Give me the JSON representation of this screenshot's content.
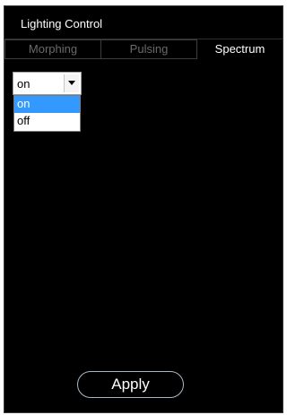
{
  "window": {
    "title": "Lighting Control"
  },
  "tabs": [
    {
      "label": "Morphing",
      "active": false
    },
    {
      "label": "Pulsing",
      "active": false
    },
    {
      "label": "Spectrum",
      "active": true
    }
  ],
  "spectrum": {
    "dropdown": {
      "selected": "on",
      "options": [
        "on",
        "off"
      ],
      "highlighted": "on",
      "arrow_icon": "chevron-down-icon"
    }
  },
  "footer": {
    "apply_label": "Apply"
  },
  "colors": {
    "background": "#000000",
    "highlight": "#3399ff",
    "button_border": "#a9b8c8"
  }
}
